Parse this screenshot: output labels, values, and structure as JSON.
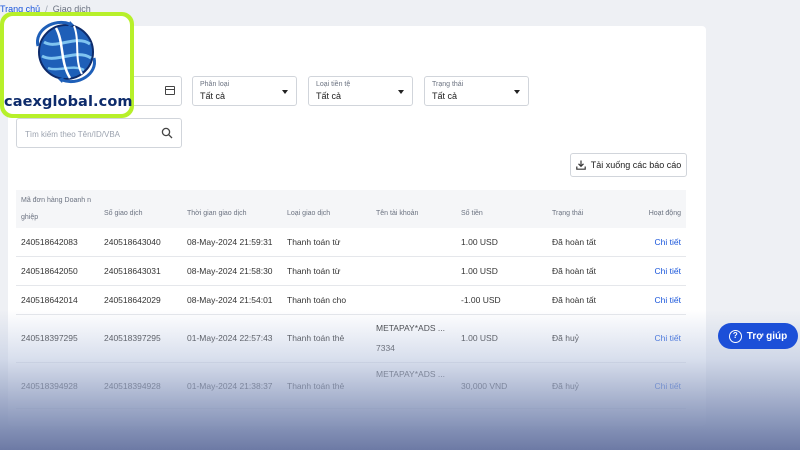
{
  "breadcrumb": {
    "home": "Trang chủ",
    "separator": "/",
    "current": "Giao dịch"
  },
  "filters": {
    "date": {
      "value": ""
    },
    "category": {
      "label": "Phân loại",
      "value": "Tất cả"
    },
    "currency": {
      "label": "Loại tiền tệ",
      "value": "Tất cả"
    },
    "status": {
      "label": "Trạng thái",
      "value": "Tất cả"
    }
  },
  "search": {
    "placeholder": "Tìm kiếm theo Tên/ID/VBA"
  },
  "download_label": "Tải xuống các báo cáo",
  "table": {
    "headers": {
      "order_id": "Mã đơn hàng Doanh n ghiệp",
      "txn_id": "Số giao dịch",
      "time": "Thời gian giao dịch",
      "type": "Loại giao dịch",
      "account": "Tên tài khoản",
      "amount": "Số tiền",
      "status": "Trạng thái",
      "action": "Hoạt động"
    },
    "rows": [
      {
        "order_id": "240518642083",
        "txn_id": "240518643040",
        "time": "08-May-2024 21:59:31",
        "type": "Thanh toán từ",
        "account_line1": "",
        "account_line2": "",
        "amount": "1.00 USD",
        "status": "Đã hoàn tất",
        "action": "Chi tiết"
      },
      {
        "order_id": "240518642050",
        "txn_id": "240518643031",
        "time": "08-May-2024 21:58:30",
        "type": "Thanh toán từ",
        "account_line1": "",
        "account_line2": "",
        "amount": "1.00 USD",
        "status": "Đã hoàn tất",
        "action": "Chi tiết"
      },
      {
        "order_id": "240518642014",
        "txn_id": "240518642029",
        "time": "08-May-2024 21:54:01",
        "type": "Thanh toán cho",
        "account_line1": "",
        "account_line2": "",
        "amount": "-1.00 USD",
        "status": "Đã hoàn tất",
        "action": "Chi tiết"
      },
      {
        "order_id": "240518397295",
        "txn_id": "240518397295",
        "time": "01-May-2024 22:57:43",
        "type": "Thanh toán thẻ",
        "account_line1": "METAPAY*ADS ...",
        "account_line2": "7334",
        "amount": "1.00 USD",
        "status": "Đã huỷ",
        "action": "Chi tiết"
      },
      {
        "order_id": "240518394928",
        "txn_id": "240518394928",
        "time": "01-May-2024 21:38:37",
        "type": "Thanh toán thẻ",
        "account_line1": "METAPAY*ADS ...",
        "account_line2": "",
        "amount": "30,000 VND",
        "status": "Đã huỷ",
        "action": "Chi tiết"
      }
    ]
  },
  "help": {
    "label": "Trợ giúp",
    "icon": "question-circle-icon"
  },
  "watermark": {
    "text": "caexglobal.com",
    "icon": "globe-icon"
  },
  "colors": {
    "accent": "#1c4fd8",
    "link": "#1a56db",
    "logo_border": "#b7f02a",
    "logo_text": "#0d2b6b"
  }
}
